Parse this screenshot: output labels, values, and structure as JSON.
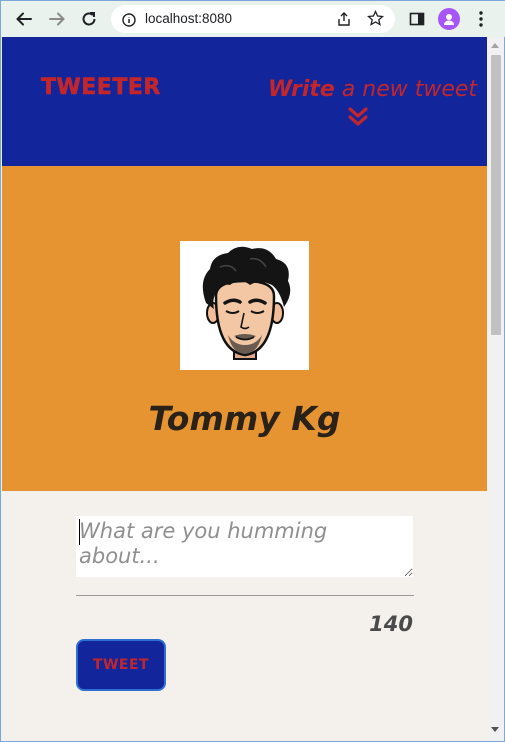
{
  "browser": {
    "url": "localhost:8080",
    "icons": [
      "back-icon",
      "forward-icon",
      "reload-icon",
      "info-icon",
      "share-icon",
      "star-icon",
      "sidebar-icon",
      "profile-icon",
      "menu-icon"
    ]
  },
  "nav": {
    "brand": "TWEETER",
    "write_strong": "Write",
    "write_rest": " a new tweet"
  },
  "profile": {
    "name": "Tommy Kg"
  },
  "compose": {
    "placeholder": "What are you humming about...",
    "value": "",
    "counter": "140",
    "button_label": "TWEET"
  },
  "colors": {
    "nav_bg": "#13259b",
    "accent_red": "#c2262b",
    "header_bg": "#e69431",
    "page_bg": "#f4f1ed"
  }
}
